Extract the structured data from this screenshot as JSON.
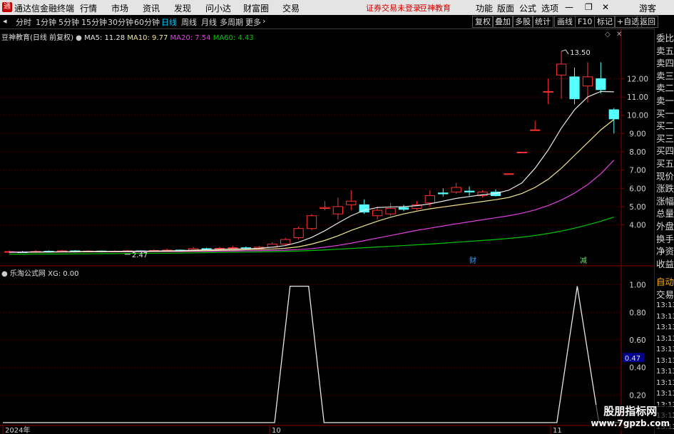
{
  "titlebar": {
    "app_title": "通达信金融终端",
    "menus": [
      "行情",
      "市场",
      "资讯",
      "发现",
      "问小达",
      "财富圈",
      "交易"
    ],
    "warning_text": "证券交易未登录",
    "brand_text": "豆神教育",
    "right_menus": [
      "功能",
      "版面",
      "公式",
      "选项"
    ],
    "guest_label": "游客"
  },
  "periods": [
    "分时",
    "1分钟",
    "5分钟",
    "15分钟",
    "30分钟",
    "60分钟",
    "日线",
    "周线",
    "月线",
    "多周期",
    "更多"
  ],
  "active_period": "日线",
  "toolbar": [
    "复权",
    "叠加",
    "多股",
    "统计",
    "画线",
    "F10",
    "标记",
    "+自选",
    "返回"
  ],
  "main_legend": {
    "stock": "豆神教育(日线 前复权)",
    "ma5": "MA5: 11.28",
    "ma10": "MA10: 9.77",
    "ma20": "MA20: 7.54",
    "ma60": "MA60: 4.43"
  },
  "colors": {
    "up": "#ff3232",
    "down": "#54ffff",
    "ma5": "#e8e8e8",
    "ma10": "#f0e68c",
    "ma20": "#e040e0",
    "ma60": "#00c800",
    "indicator": "#e8e8e8"
  },
  "price_axis": [
    "12.00",
    "11.00",
    "10.00",
    "9.00",
    "8.00",
    "7.00",
    "6.00",
    "5.00",
    "4.00"
  ],
  "annotations": {
    "high": "13.50",
    "low": "2.47",
    "cai_marker": "财",
    "jian_marker": "减"
  },
  "indicator_legend": {
    "name": "乐淘公式网",
    "value": "XG: 0.00"
  },
  "indicator_axis": [
    "1.00",
    "0.80",
    "0.60",
    "0.40",
    "0.20"
  ],
  "indicator_cursor": "0.47",
  "date_labels": [
    "2024年",
    "10",
    "11"
  ],
  "side_panel": [
    "委比",
    "卖五",
    "卖四",
    "卖三",
    "卖二",
    "卖一",
    "买一",
    "买二",
    "买三",
    "买四",
    "买五",
    "现价",
    "涨跌",
    "涨幅",
    "总量",
    "外盘",
    "换手",
    "净资",
    "收益"
  ],
  "side_lower": {
    "auto": "自动",
    "trade": "交易",
    "times": [
      "13:13",
      "13:13",
      "13:13",
      "13:13",
      "13:13",
      "13:13",
      "13:13",
      "13:13",
      "13:13",
      "13:13",
      "13:13",
      "13:13"
    ]
  },
  "watermark": {
    "line1": "股朋指标网",
    "line2": "www.7gpzb.com"
  },
  "chart_data": {
    "type": "candlestick",
    "ylim": [
      1.8,
      14.2
    ],
    "candles": [
      {
        "o": 2.5,
        "c": 2.54,
        "h": 2.6,
        "l": 2.45
      },
      {
        "o": 2.52,
        "c": 2.5,
        "h": 2.58,
        "l": 2.47
      },
      {
        "o": 2.5,
        "c": 2.55,
        "h": 2.62,
        "l": 2.47
      },
      {
        "o": 2.56,
        "c": 2.52,
        "h": 2.6,
        "l": 2.48
      },
      {
        "o": 2.52,
        "c": 2.58,
        "h": 2.63,
        "l": 2.5
      },
      {
        "o": 2.58,
        "c": 2.55,
        "h": 2.62,
        "l": 2.5
      },
      {
        "o": 2.55,
        "c": 2.57,
        "h": 2.61,
        "l": 2.52
      },
      {
        "o": 2.57,
        "c": 2.53,
        "h": 2.6,
        "l": 2.49
      },
      {
        "o": 2.53,
        "c": 2.56,
        "h": 2.6,
        "l": 2.5
      },
      {
        "o": 2.56,
        "c": 2.58,
        "h": 2.63,
        "l": 2.53
      },
      {
        "o": 2.58,
        "c": 2.55,
        "h": 2.61,
        "l": 2.52
      },
      {
        "o": 2.55,
        "c": 2.6,
        "h": 2.66,
        "l": 2.53
      },
      {
        "o": 2.6,
        "c": 2.62,
        "h": 2.7,
        "l": 2.56
      },
      {
        "o": 2.62,
        "c": 2.58,
        "h": 2.66,
        "l": 2.55
      },
      {
        "o": 2.58,
        "c": 2.7,
        "h": 2.8,
        "l": 2.56
      },
      {
        "o": 2.7,
        "c": 2.68,
        "h": 2.75,
        "l": 2.62
      },
      {
        "o": 2.68,
        "c": 2.72,
        "h": 2.8,
        "l": 2.65
      },
      {
        "o": 2.72,
        "c": 2.75,
        "h": 2.85,
        "l": 2.68
      },
      {
        "o": 2.75,
        "c": 2.7,
        "h": 2.82,
        "l": 2.66
      },
      {
        "o": 2.7,
        "c": 2.78,
        "h": 2.85,
        "l": 2.67
      },
      {
        "o": 2.78,
        "c": 2.95,
        "h": 3.05,
        "l": 2.75
      },
      {
        "o": 2.95,
        "c": 3.2,
        "h": 3.3,
        "l": 2.9
      },
      {
        "o": 3.3,
        "c": 3.8,
        "h": 3.9,
        "l": 3.2
      },
      {
        "o": 3.8,
        "c": 4.5,
        "h": 4.6,
        "l": 3.7
      },
      {
        "o": 4.9,
        "c": 4.95,
        "h": 5.3,
        "l": 4.8
      },
      {
        "o": 4.6,
        "c": 5.0,
        "h": 5.5,
        "l": 4.3
      },
      {
        "o": 5.1,
        "c": 5.3,
        "h": 5.9,
        "l": 4.8
      },
      {
        "o": 5.1,
        "c": 4.7,
        "h": 5.4,
        "l": 4.6
      },
      {
        "o": 4.5,
        "c": 4.8,
        "h": 5.0,
        "l": 4.3
      },
      {
        "o": 4.6,
        "c": 4.9,
        "h": 5.2,
        "l": 4.5
      },
      {
        "o": 4.95,
        "c": 4.85,
        "h": 5.1,
        "l": 4.75
      },
      {
        "o": 4.9,
        "c": 5.1,
        "h": 5.3,
        "l": 4.8
      },
      {
        "o": 5.2,
        "c": 5.6,
        "h": 5.9,
        "l": 5.0
      },
      {
        "o": 5.75,
        "c": 5.7,
        "h": 6.0,
        "l": 5.55
      },
      {
        "o": 5.8,
        "c": 6.05,
        "h": 6.3,
        "l": 5.7
      },
      {
        "o": 5.85,
        "c": 5.8,
        "h": 6.1,
        "l": 5.6
      },
      {
        "o": 5.6,
        "c": 5.8,
        "h": 5.9,
        "l": 5.5
      },
      {
        "o": 5.8,
        "c": 5.6,
        "h": 5.95,
        "l": 5.55
      },
      {
        "o": 6.8,
        "c": 6.8,
        "h": 6.8,
        "l": 6.8
      },
      {
        "o": 7.98,
        "c": 7.98,
        "h": 7.98,
        "l": 7.98
      },
      {
        "o": 9.2,
        "c": 9.2,
        "h": 9.7,
        "l": 9.2
      },
      {
        "o": 11.3,
        "c": 11.3,
        "h": 12.0,
        "l": 10.6
      },
      {
        "o": 12.2,
        "c": 12.8,
        "h": 13.5,
        "l": 10.9
      },
      {
        "o": 12.1,
        "c": 10.9,
        "h": 12.6,
        "l": 10.6
      },
      {
        "o": 11.6,
        "c": 12.1,
        "h": 12.9,
        "l": 10.7
      },
      {
        "o": 12.0,
        "c": 11.4,
        "h": 12.9,
        "l": 11.2
      },
      {
        "o": 10.3,
        "c": 9.8,
        "h": 10.4,
        "l": 9.0
      }
    ],
    "ma5": [
      2.5,
      2.51,
      2.52,
      2.52,
      2.53,
      2.54,
      2.55,
      2.55,
      2.55,
      2.56,
      2.56,
      2.57,
      2.58,
      2.59,
      2.62,
      2.64,
      2.66,
      2.68,
      2.7,
      2.72,
      2.78,
      2.87,
      3.05,
      3.32,
      3.68,
      4.1,
      4.5,
      4.8,
      4.95,
      4.98,
      5.0,
      5.05,
      5.15,
      5.3,
      5.45,
      5.55,
      5.65,
      5.72,
      5.9,
      6.3,
      7.1,
      8.1,
      9.3,
      10.3,
      11.0,
      11.3,
      11.28
    ],
    "ma10": [
      2.5,
      2.5,
      2.51,
      2.51,
      2.52,
      2.52,
      2.53,
      2.53,
      2.54,
      2.54,
      2.55,
      2.55,
      2.56,
      2.57,
      2.58,
      2.59,
      2.61,
      2.62,
      2.64,
      2.66,
      2.68,
      2.72,
      2.8,
      2.95,
      3.15,
      3.4,
      3.7,
      3.95,
      4.2,
      4.42,
      4.6,
      4.75,
      4.88,
      4.98,
      5.08,
      5.18,
      5.28,
      5.38,
      5.5,
      5.72,
      6.05,
      6.5,
      7.1,
      7.8,
      8.5,
      9.2,
      9.77
    ],
    "ma20": [
      2.52,
      2.52,
      2.52,
      2.52,
      2.52,
      2.52,
      2.53,
      2.53,
      2.53,
      2.53,
      2.53,
      2.54,
      2.54,
      2.54,
      2.55,
      2.55,
      2.56,
      2.57,
      2.58,
      2.59,
      2.6,
      2.62,
      2.65,
      2.7,
      2.78,
      2.88,
      3.0,
      3.14,
      3.28,
      3.42,
      3.56,
      3.7,
      3.82,
      3.94,
      4.06,
      4.17,
      4.28,
      4.39,
      4.5,
      4.64,
      4.82,
      5.06,
      5.36,
      5.74,
      6.2,
      6.8,
      7.54
    ],
    "ma60": [
      2.4,
      2.4,
      2.41,
      2.41,
      2.41,
      2.42,
      2.42,
      2.43,
      2.43,
      2.44,
      2.44,
      2.45,
      2.45,
      2.46,
      2.47,
      2.48,
      2.49,
      2.5,
      2.51,
      2.52,
      2.53,
      2.55,
      2.57,
      2.6,
      2.63,
      2.67,
      2.71,
      2.75,
      2.79,
      2.83,
      2.87,
      2.91,
      2.95,
      3.0,
      3.05,
      3.1,
      3.15,
      3.2,
      3.26,
      3.33,
      3.42,
      3.53,
      3.66,
      3.82,
      4.0,
      4.2,
      4.43
    ],
    "indicator": {
      "ylim": [
        0,
        1.05
      ],
      "points": [
        [
          0,
          0
        ],
        [
          0.44,
          0
        ],
        [
          0.465,
          0.99
        ],
        [
          0.495,
          0.99
        ],
        [
          0.52,
          0
        ],
        [
          0.897,
          0
        ],
        [
          0.93,
          0.99
        ],
        [
          0.965,
          0
        ],
        [
          1,
          0
        ]
      ]
    }
  }
}
